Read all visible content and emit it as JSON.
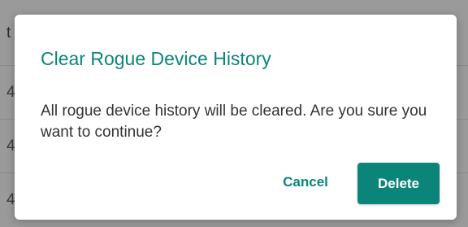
{
  "background": {
    "header_fragment": "t",
    "rows": [
      "4",
      "4",
      "4"
    ]
  },
  "dialog": {
    "title": "Clear Rogue Device History",
    "message": "All rogue device history will be cleared. Are you sure you want to continue?",
    "cancel_label": "Cancel",
    "delete_label": "Delete"
  },
  "colors": {
    "accent": "#0b857a",
    "backdrop": "#9a9a9a",
    "text": "#333333"
  }
}
